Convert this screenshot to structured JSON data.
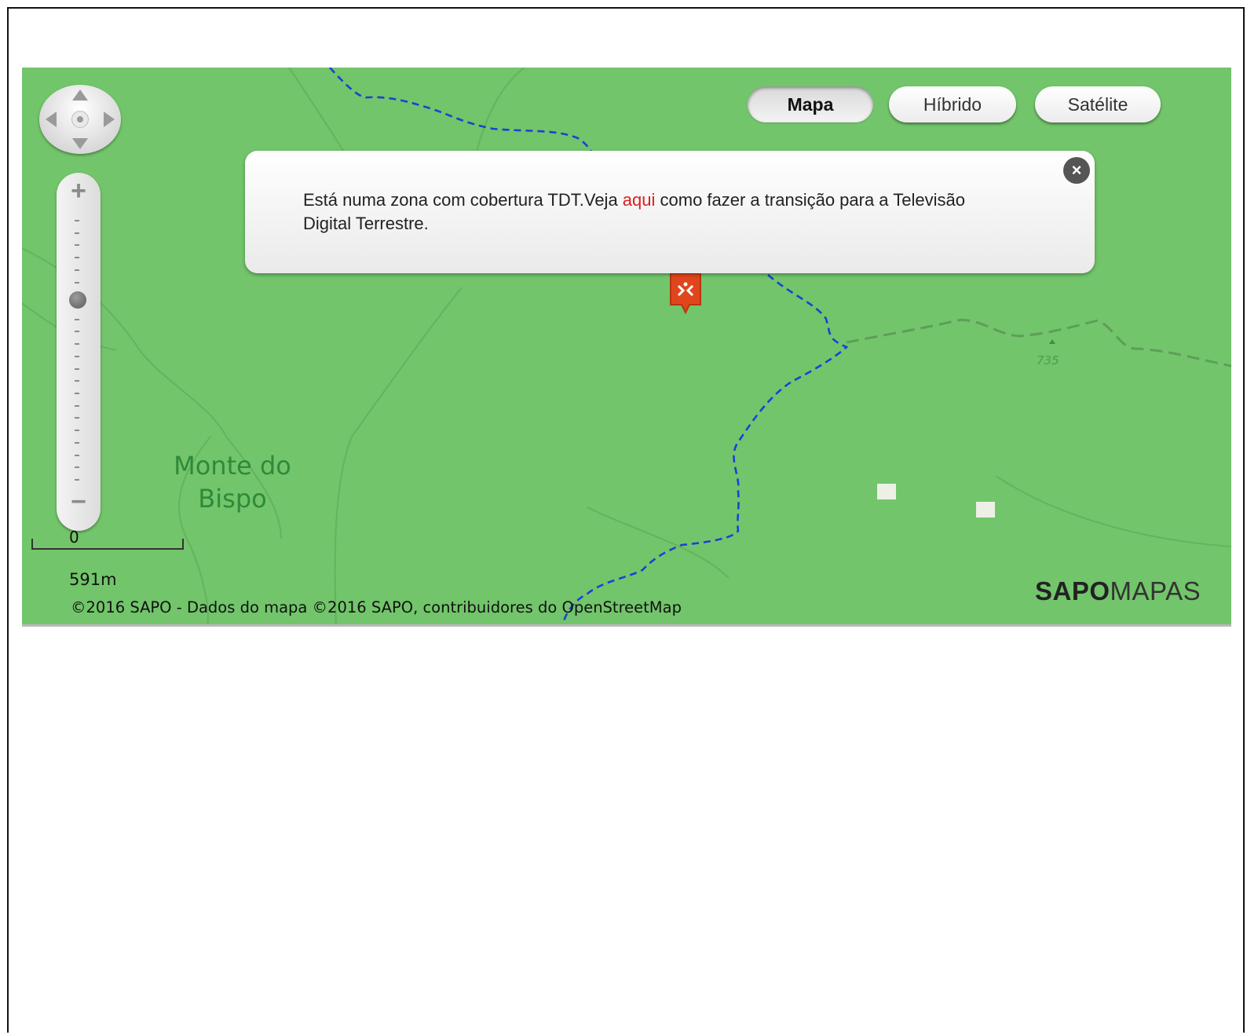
{
  "map_type_buttons": [
    {
      "label": "Mapa",
      "active": true
    },
    {
      "label": "Híbrido",
      "active": false
    },
    {
      "label": "Satélite",
      "active": false
    }
  ],
  "popup": {
    "text_before": "Está numa zona com cobertura TDT.Veja ",
    "link_text": "aqui",
    "text_after": " como fazer a transição para a Televisão Digital Terrestre.",
    "link_color": "#d81f1f"
  },
  "map_labels": {
    "place_line1": "Monte do",
    "place_line2": "Bispo",
    "peak_elevation": "735"
  },
  "scale": {
    "zero_label": "0",
    "distance_label": "591m"
  },
  "attribution": "©2016 SAPO - Dados do mapa ©2016 SAPO, contribuidores do OpenStreetMap",
  "logo": {
    "part1": "SAPO",
    "part2": "MAPAS"
  },
  "zoom": {
    "in_symbol": "+",
    "out_symbol": "−",
    "level_fraction": 0.31
  },
  "icons": {
    "pan": "pan-control-icon",
    "close": "close-icon",
    "marker": "tdt-antenna-marker-icon",
    "peak": "peak-triangle-icon"
  },
  "colors": {
    "map_background": "#72c56a",
    "river": "#1f3fd8",
    "marker": "#e0461c",
    "logo_text": "#222222"
  }
}
